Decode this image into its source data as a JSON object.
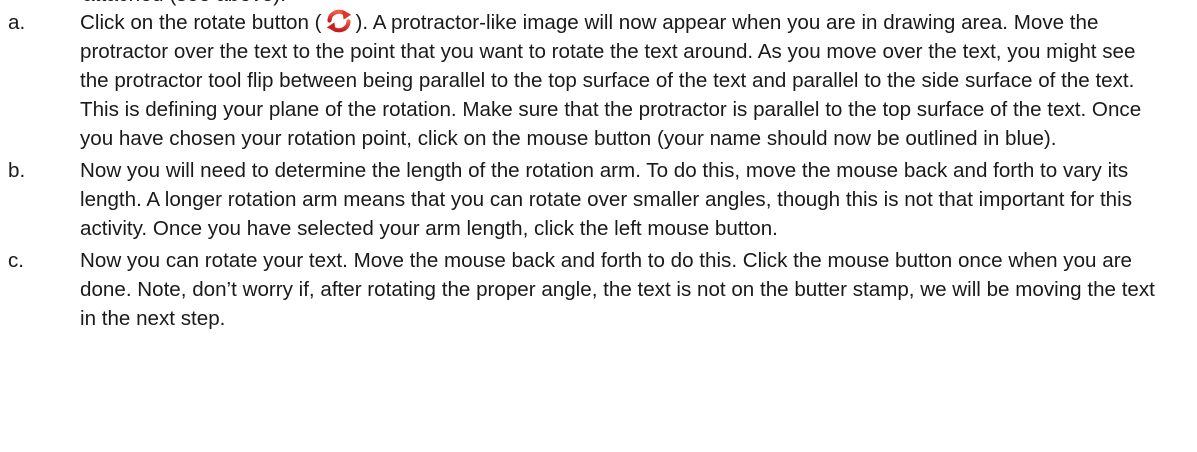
{
  "clipped_top_line": "attached (see above).",
  "steps": [
    {
      "marker": "a.",
      "before_icon": "Click on the rotate button (",
      "icon": "rotate-icon",
      "after_icon": "). A protractor-like image will now appear when you are in drawing area. Move the protractor over the text to the point that you want to rotate the text around. As you move over the text, you might see the protractor tool flip between being parallel to the top surface of the text and parallel to the side surface of the text. This is defining your plane of the rotation. Make sure that the protractor is parallel to the top surface of the text. Once you have chosen your rotation point, click on the mouse button (your name should now be outlined in blue)."
    },
    {
      "marker": "b.",
      "text": "Now you will need to determine the length of the rotation arm. To do this, move the mouse back and forth to vary its length. A longer rotation arm means that you can rotate over smaller angles, though this is not that important for this activity. Once you have selected your arm length, click the left mouse button."
    },
    {
      "marker": "c.",
      "text": "Now you can rotate your text. Move the mouse back and forth to do this. Click the mouse button once when you are done. Note, don’t worry if, after rotating the proper angle, the text is not on the butter stamp, we will be moving the text in the next step."
    }
  ],
  "colors": {
    "text": "#1a1a1a",
    "icon_red": "#e32b2b",
    "icon_red_dark": "#b71c1c"
  }
}
